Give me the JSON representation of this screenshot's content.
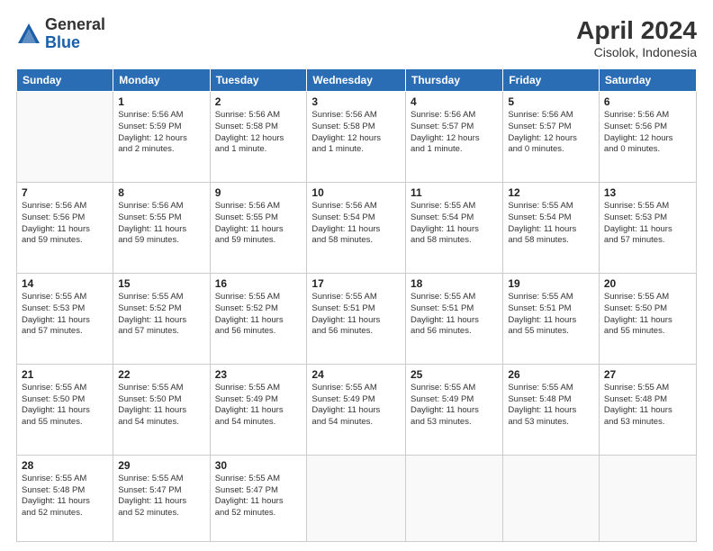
{
  "header": {
    "logo_general": "General",
    "logo_blue": "Blue",
    "month_year": "April 2024",
    "location": "Cisolok, Indonesia"
  },
  "calendar": {
    "days_of_week": [
      "Sunday",
      "Monday",
      "Tuesday",
      "Wednesday",
      "Thursday",
      "Friday",
      "Saturday"
    ],
    "weeks": [
      [
        {
          "day": "",
          "info": ""
        },
        {
          "day": "1",
          "info": "Sunrise: 5:56 AM\nSunset: 5:59 PM\nDaylight: 12 hours\nand 2 minutes."
        },
        {
          "day": "2",
          "info": "Sunrise: 5:56 AM\nSunset: 5:58 PM\nDaylight: 12 hours\nand 1 minute."
        },
        {
          "day": "3",
          "info": "Sunrise: 5:56 AM\nSunset: 5:58 PM\nDaylight: 12 hours\nand 1 minute."
        },
        {
          "day": "4",
          "info": "Sunrise: 5:56 AM\nSunset: 5:57 PM\nDaylight: 12 hours\nand 1 minute."
        },
        {
          "day": "5",
          "info": "Sunrise: 5:56 AM\nSunset: 5:57 PM\nDaylight: 12 hours\nand 0 minutes."
        },
        {
          "day": "6",
          "info": "Sunrise: 5:56 AM\nSunset: 5:56 PM\nDaylight: 12 hours\nand 0 minutes."
        }
      ],
      [
        {
          "day": "7",
          "info": "Sunrise: 5:56 AM\nSunset: 5:56 PM\nDaylight: 11 hours\nand 59 minutes."
        },
        {
          "day": "8",
          "info": "Sunrise: 5:56 AM\nSunset: 5:55 PM\nDaylight: 11 hours\nand 59 minutes."
        },
        {
          "day": "9",
          "info": "Sunrise: 5:56 AM\nSunset: 5:55 PM\nDaylight: 11 hours\nand 59 minutes."
        },
        {
          "day": "10",
          "info": "Sunrise: 5:56 AM\nSunset: 5:54 PM\nDaylight: 11 hours\nand 58 minutes."
        },
        {
          "day": "11",
          "info": "Sunrise: 5:55 AM\nSunset: 5:54 PM\nDaylight: 11 hours\nand 58 minutes."
        },
        {
          "day": "12",
          "info": "Sunrise: 5:55 AM\nSunset: 5:54 PM\nDaylight: 11 hours\nand 58 minutes."
        },
        {
          "day": "13",
          "info": "Sunrise: 5:55 AM\nSunset: 5:53 PM\nDaylight: 11 hours\nand 57 minutes."
        }
      ],
      [
        {
          "day": "14",
          "info": "Sunrise: 5:55 AM\nSunset: 5:53 PM\nDaylight: 11 hours\nand 57 minutes."
        },
        {
          "day": "15",
          "info": "Sunrise: 5:55 AM\nSunset: 5:52 PM\nDaylight: 11 hours\nand 57 minutes."
        },
        {
          "day": "16",
          "info": "Sunrise: 5:55 AM\nSunset: 5:52 PM\nDaylight: 11 hours\nand 56 minutes."
        },
        {
          "day": "17",
          "info": "Sunrise: 5:55 AM\nSunset: 5:51 PM\nDaylight: 11 hours\nand 56 minutes."
        },
        {
          "day": "18",
          "info": "Sunrise: 5:55 AM\nSunset: 5:51 PM\nDaylight: 11 hours\nand 56 minutes."
        },
        {
          "day": "19",
          "info": "Sunrise: 5:55 AM\nSunset: 5:51 PM\nDaylight: 11 hours\nand 55 minutes."
        },
        {
          "day": "20",
          "info": "Sunrise: 5:55 AM\nSunset: 5:50 PM\nDaylight: 11 hours\nand 55 minutes."
        }
      ],
      [
        {
          "day": "21",
          "info": "Sunrise: 5:55 AM\nSunset: 5:50 PM\nDaylight: 11 hours\nand 55 minutes."
        },
        {
          "day": "22",
          "info": "Sunrise: 5:55 AM\nSunset: 5:50 PM\nDaylight: 11 hours\nand 54 minutes."
        },
        {
          "day": "23",
          "info": "Sunrise: 5:55 AM\nSunset: 5:49 PM\nDaylight: 11 hours\nand 54 minutes."
        },
        {
          "day": "24",
          "info": "Sunrise: 5:55 AM\nSunset: 5:49 PM\nDaylight: 11 hours\nand 54 minutes."
        },
        {
          "day": "25",
          "info": "Sunrise: 5:55 AM\nSunset: 5:49 PM\nDaylight: 11 hours\nand 53 minutes."
        },
        {
          "day": "26",
          "info": "Sunrise: 5:55 AM\nSunset: 5:48 PM\nDaylight: 11 hours\nand 53 minutes."
        },
        {
          "day": "27",
          "info": "Sunrise: 5:55 AM\nSunset: 5:48 PM\nDaylight: 11 hours\nand 53 minutes."
        }
      ],
      [
        {
          "day": "28",
          "info": "Sunrise: 5:55 AM\nSunset: 5:48 PM\nDaylight: 11 hours\nand 52 minutes."
        },
        {
          "day": "29",
          "info": "Sunrise: 5:55 AM\nSunset: 5:47 PM\nDaylight: 11 hours\nand 52 minutes."
        },
        {
          "day": "30",
          "info": "Sunrise: 5:55 AM\nSunset: 5:47 PM\nDaylight: 11 hours\nand 52 minutes."
        },
        {
          "day": "",
          "info": ""
        },
        {
          "day": "",
          "info": ""
        },
        {
          "day": "",
          "info": ""
        },
        {
          "day": "",
          "info": ""
        }
      ]
    ]
  }
}
